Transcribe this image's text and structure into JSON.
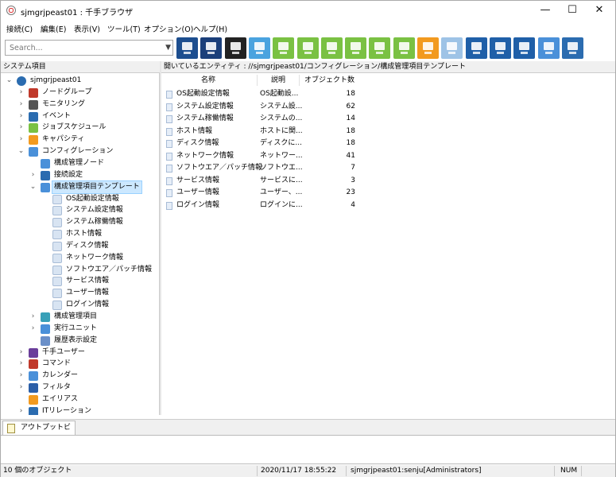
{
  "window": {
    "title": "sjmgrjpeast01 : 千手ブラウザ",
    "minimize_glyph": "—",
    "maximize_glyph": "☐",
    "close_glyph": "✕"
  },
  "menu": [
    "接続(C)",
    "編集(E)",
    "表示(V)",
    "ツール(T)",
    "オプション(O)",
    "ヘルプ(H)"
  ],
  "search": {
    "placeholder": "Search..."
  },
  "toolbar_icons": [
    {
      "name": "node-map-icon",
      "color": "#1d4e8f"
    },
    {
      "name": "monitor-icon",
      "color": "#1b3f7a"
    },
    {
      "name": "command-terminal-icon",
      "color": "#222222"
    },
    {
      "name": "message-icon",
      "color": "#4aa3df"
    },
    {
      "name": "gear-check-icon",
      "color": "#7ac143"
    },
    {
      "name": "puzzle-gear-icon",
      "color": "#7ac143"
    },
    {
      "name": "puzzle-arrow-icon",
      "color": "#7ac143"
    },
    {
      "name": "checklist-icon",
      "color": "#7ac143"
    },
    {
      "name": "bar-chart-icon",
      "color": "#7ac143"
    },
    {
      "name": "report-icon",
      "color": "#7ac143"
    },
    {
      "name": "statistics-icon",
      "color": "#f29a1f"
    },
    {
      "name": "grid-tile-icon",
      "color": "#9ec3e6"
    },
    {
      "name": "export-icon",
      "color": "#1f5fa8"
    },
    {
      "name": "edit-export-icon",
      "color": "#1f5fa8"
    },
    {
      "name": "upload-export-icon",
      "color": "#1f5fa8"
    },
    {
      "name": "log-icon",
      "color": "#4a90d9"
    },
    {
      "name": "radar-icon",
      "color": "#2b6cb0"
    }
  ],
  "tree": {
    "header": "システム項目",
    "items": [
      {
        "label": "sjmgrjpeast01",
        "icon": "globe-icon",
        "expanded": true
      },
      {
        "label": "ノードグループ",
        "icon": "node-group-icon"
      },
      {
        "label": "モニタリング",
        "icon": "monitoring-icon"
      },
      {
        "label": "イベント",
        "icon": "event-icon"
      },
      {
        "label": "ジョブスケジュール",
        "icon": "job-schedule-icon"
      },
      {
        "label": "キャパシティ",
        "icon": "capacity-icon"
      },
      {
        "label": "コンフィグレーション",
        "icon": "configuration-icon",
        "expanded": true
      },
      {
        "label": "構成管理ノード",
        "icon": "config-node-icon"
      },
      {
        "label": "接続設定",
        "icon": "link-icon"
      },
      {
        "label": "構成管理項目テンプレート",
        "icon": "template-icon",
        "expanded": true,
        "selected": true
      },
      {
        "label": "OS起動設定情報",
        "icon": "template-item-icon"
      },
      {
        "label": "システム設定情報",
        "icon": "template-item-icon"
      },
      {
        "label": "システム稼働情報",
        "icon": "template-item-icon"
      },
      {
        "label": "ホスト情報",
        "icon": "template-item-icon"
      },
      {
        "label": "ディスク情報",
        "icon": "template-item-icon"
      },
      {
        "label": "ネットワーク情報",
        "icon": "template-item-icon"
      },
      {
        "label": "ソフトウエア／パッチ情報",
        "icon": "template-item-icon"
      },
      {
        "label": "サービス情報",
        "icon": "template-item-icon"
      },
      {
        "label": "ユーザー情報",
        "icon": "template-item-icon"
      },
      {
        "label": "ログイン情報",
        "icon": "template-item-icon"
      },
      {
        "label": "構成管理項目",
        "icon": "config-item-icon"
      },
      {
        "label": "実行ユニット",
        "icon": "exec-unit-icon"
      },
      {
        "label": "履歴表示設定",
        "icon": "history-icon"
      },
      {
        "label": "千手ユーザー",
        "icon": "user-icon"
      },
      {
        "label": "コマンド",
        "icon": "command-icon"
      },
      {
        "label": "カレンダー",
        "icon": "calendar-icon"
      },
      {
        "label": "フィルタ",
        "icon": "filter-icon"
      },
      {
        "label": "エイリアス",
        "icon": "alias-icon"
      },
      {
        "label": "ITリレーション",
        "icon": "it-relation-icon"
      }
    ]
  },
  "list": {
    "header": "開いているエンティティ : //sjmgrjpeast01/コンフィグレーション/構成管理項目テンプレート",
    "columns": [
      "名称",
      "説明",
      "オブジェクト数"
    ],
    "rows": [
      {
        "name": "OS起動設定情報",
        "desc": "OS起動設...",
        "count": "18"
      },
      {
        "name": "システム設定情報",
        "desc": "システム設...",
        "count": "62"
      },
      {
        "name": "システム稼働情報",
        "desc": "システムの...",
        "count": "14"
      },
      {
        "name": "ホスト情報",
        "desc": "ホストに関...",
        "count": "18"
      },
      {
        "name": "ディスク情報",
        "desc": "ディスクに...",
        "count": "18"
      },
      {
        "name": "ネットワーク情報",
        "desc": "ネットワー...",
        "count": "41"
      },
      {
        "name": "ソフトウエア／パッチ情報",
        "desc": "ソフトウエ...",
        "count": "7"
      },
      {
        "name": "サービス情報",
        "desc": "サービスに...",
        "count": "3"
      },
      {
        "name": "ユーザー情報",
        "desc": "ユーザー、...",
        "count": "23"
      },
      {
        "name": "ログイン情報",
        "desc": "ログインに...",
        "count": "4"
      }
    ]
  },
  "output": {
    "tab_label": "アウトプットビュー"
  },
  "status": {
    "objects": "10 個のオブジェクト",
    "datetime": "2020/11/17 18:55:22",
    "user": "sjmgrjpeast01:senju[Administrators]",
    "numlock": "NUM"
  }
}
